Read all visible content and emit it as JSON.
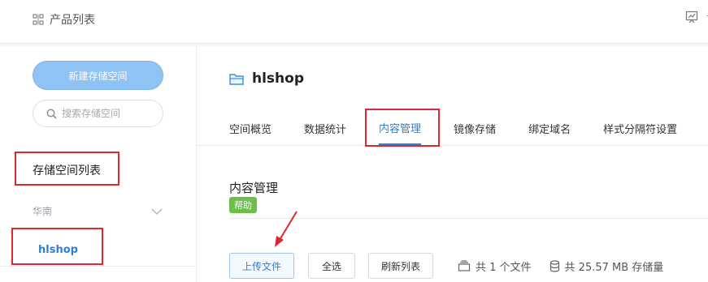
{
  "topbar": {
    "product_list": "产品列表",
    "right_text": "专"
  },
  "sidebar": {
    "new_bucket_label": "新建存储空间",
    "search_placeholder": "搜索存储空间",
    "list_title": "存储空间列表",
    "region": "华南",
    "bucket_item": "hlshop"
  },
  "bucket": {
    "name": "hlshop"
  },
  "tabs": [
    "空间概览",
    "数据统计",
    "内容管理",
    "镜像存储",
    "绑定域名",
    "样式分隔符设置"
  ],
  "content": {
    "title": "内容管理",
    "help_label": "帮助",
    "upload_label": "上传文件",
    "select_all_label": "全选",
    "refresh_label": "刷新列表",
    "file_count": "共 1 个文件",
    "storage_total": "共 25.57 MB 存储量"
  },
  "colors": {
    "accent": "#2f7fd9",
    "help_badge": "#6cc04a",
    "highlight": "#e4252f"
  }
}
